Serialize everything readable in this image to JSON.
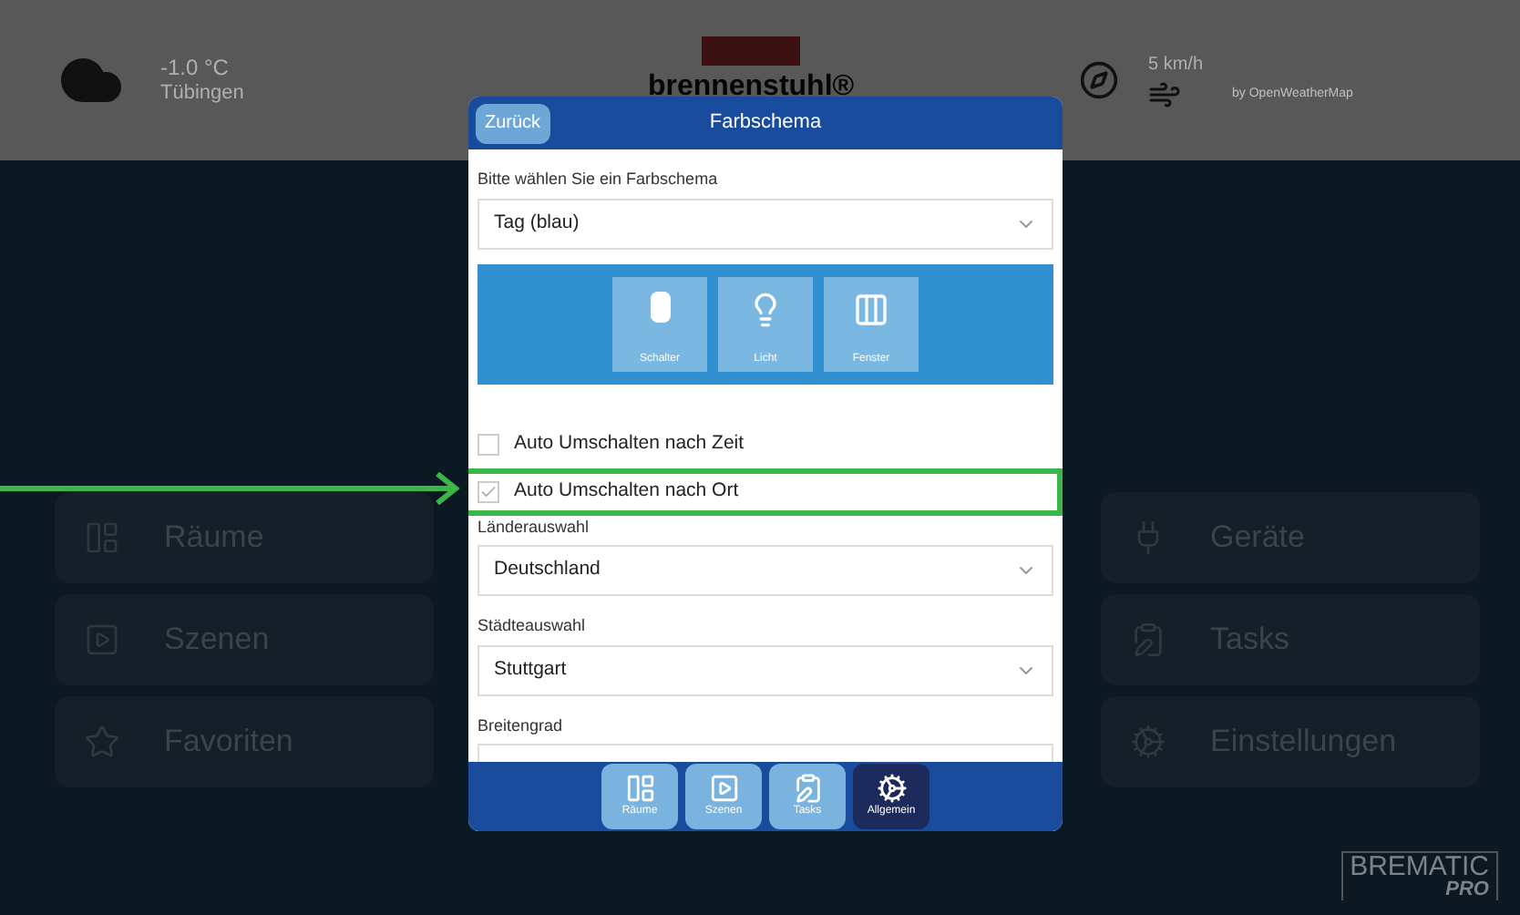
{
  "weather": {
    "temperature": "-1.0 °C",
    "city": "Tübingen",
    "wind_speed": "5 km/h",
    "credit": "by OpenWeatherMap"
  },
  "brand": {
    "logo": "brennenstuhl®",
    "app_logo": "BREMATIC",
    "app_logo_sub": "PRO"
  },
  "menu_left": [
    {
      "label": "Räume"
    },
    {
      "label": "Szenen"
    },
    {
      "label": "Favoriten"
    }
  ],
  "menu_right": [
    {
      "label": "Geräte"
    },
    {
      "label": "Tasks"
    },
    {
      "label": "Einstellungen"
    }
  ],
  "dialog": {
    "back_button": "Zurück",
    "title": "Farbschema",
    "scheme": {
      "label": "Bitte wählen Sie ein Farbschema",
      "value": "Tag (blau)"
    },
    "preview_tiles": [
      {
        "label": "Schalter"
      },
      {
        "label": "Licht"
      },
      {
        "label": "Fenster"
      }
    ],
    "options": [
      {
        "label": "Auto Umschalten nach Zeit",
        "checked": false,
        "highlighted": false
      },
      {
        "label": "Auto Umschalten nach Ort",
        "checked": true,
        "highlighted": true
      }
    ],
    "country": {
      "label": "Länderauswahl",
      "value": "Deutschland"
    },
    "city": {
      "label": "Städteauswahl",
      "value": "Stuttgart"
    },
    "latitude": {
      "label": "Breitengrad"
    },
    "nav": [
      {
        "label": "Räume",
        "selected": false
      },
      {
        "label": "Szenen",
        "selected": false
      },
      {
        "label": "Tasks",
        "selected": false
      },
      {
        "label": "Allgemein",
        "selected": true
      }
    ]
  }
}
